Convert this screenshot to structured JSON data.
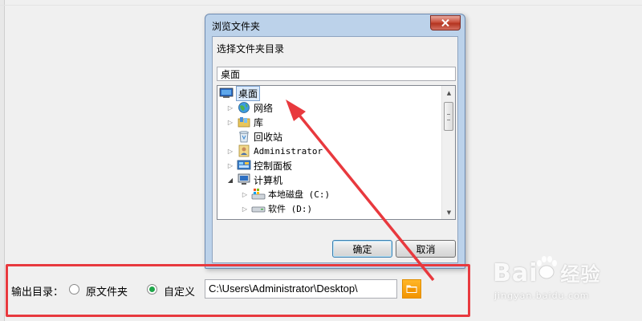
{
  "dialog": {
    "title": "浏览文件夹",
    "instruction": "选择文件夹目录",
    "path_value": "桌面",
    "ok_label": "确定",
    "cancel_label": "取消"
  },
  "tree": {
    "items": [
      {
        "label": "桌面",
        "icon": "desktop-icon",
        "expander": "",
        "selected": true
      },
      {
        "label": "网络",
        "icon": "network-globe-icon",
        "expander": "▷"
      },
      {
        "label": "库",
        "icon": "library-icon",
        "expander": "▷"
      },
      {
        "label": "回收站",
        "icon": "recycle-bin-icon",
        "expander": ""
      },
      {
        "label": "Administrator",
        "icon": "user-folder-icon",
        "expander": "▷"
      },
      {
        "label": "控制面板",
        "icon": "control-panel-icon",
        "expander": "▷"
      },
      {
        "label": "计算机",
        "icon": "computer-icon",
        "expander": "◢"
      },
      {
        "label": "本地磁盘 (C:)",
        "icon": "system-drive-icon",
        "expander": "▷"
      },
      {
        "label": "软件 (D:)",
        "icon": "drive-icon",
        "expander": "▷"
      }
    ]
  },
  "output": {
    "label": "输出目录：",
    "option_original": "原文件夹",
    "option_custom": "自定义",
    "selected_option": "自定义",
    "path": "C:\\Users\\Administrator\\Desktop\\"
  },
  "watermark": {
    "brand": "Bai",
    "brand_suffix": "经验",
    "url": "jingyan.baidu.com"
  },
  "colors": {
    "annotation_red": "#e8393e",
    "radio_green": "#1fa64a",
    "browse_orange": "#f29400",
    "dialog_frame": "#bcd2ea"
  }
}
